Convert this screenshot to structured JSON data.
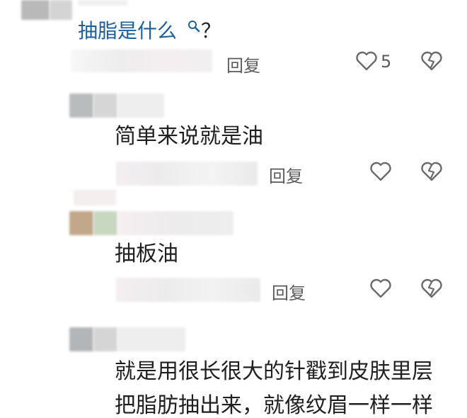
{
  "comments": [
    {
      "link_text": "抽脂是什么",
      "suffix": "？",
      "search_icon": "search-icon",
      "reply_label": "回复",
      "like_count": "5"
    },
    {
      "text": "简单来说就是油",
      "reply_label": "回复"
    },
    {
      "text": "抽板油",
      "reply_label": "回复"
    },
    {
      "text_lines": [
        "就是用很长很大的针戳到皮肤里层",
        "把脂肪抽出来，就像纹眉一样一样"
      ]
    }
  ],
  "icons": {
    "like": "heart-outline-icon",
    "dislike": "broken-heart-icon",
    "search": "search-icon"
  },
  "colors": {
    "link": "#1a5f9e",
    "text": "#1f1f1f",
    "muted": "#5b5b5b",
    "icon": "#6a6a6a"
  }
}
